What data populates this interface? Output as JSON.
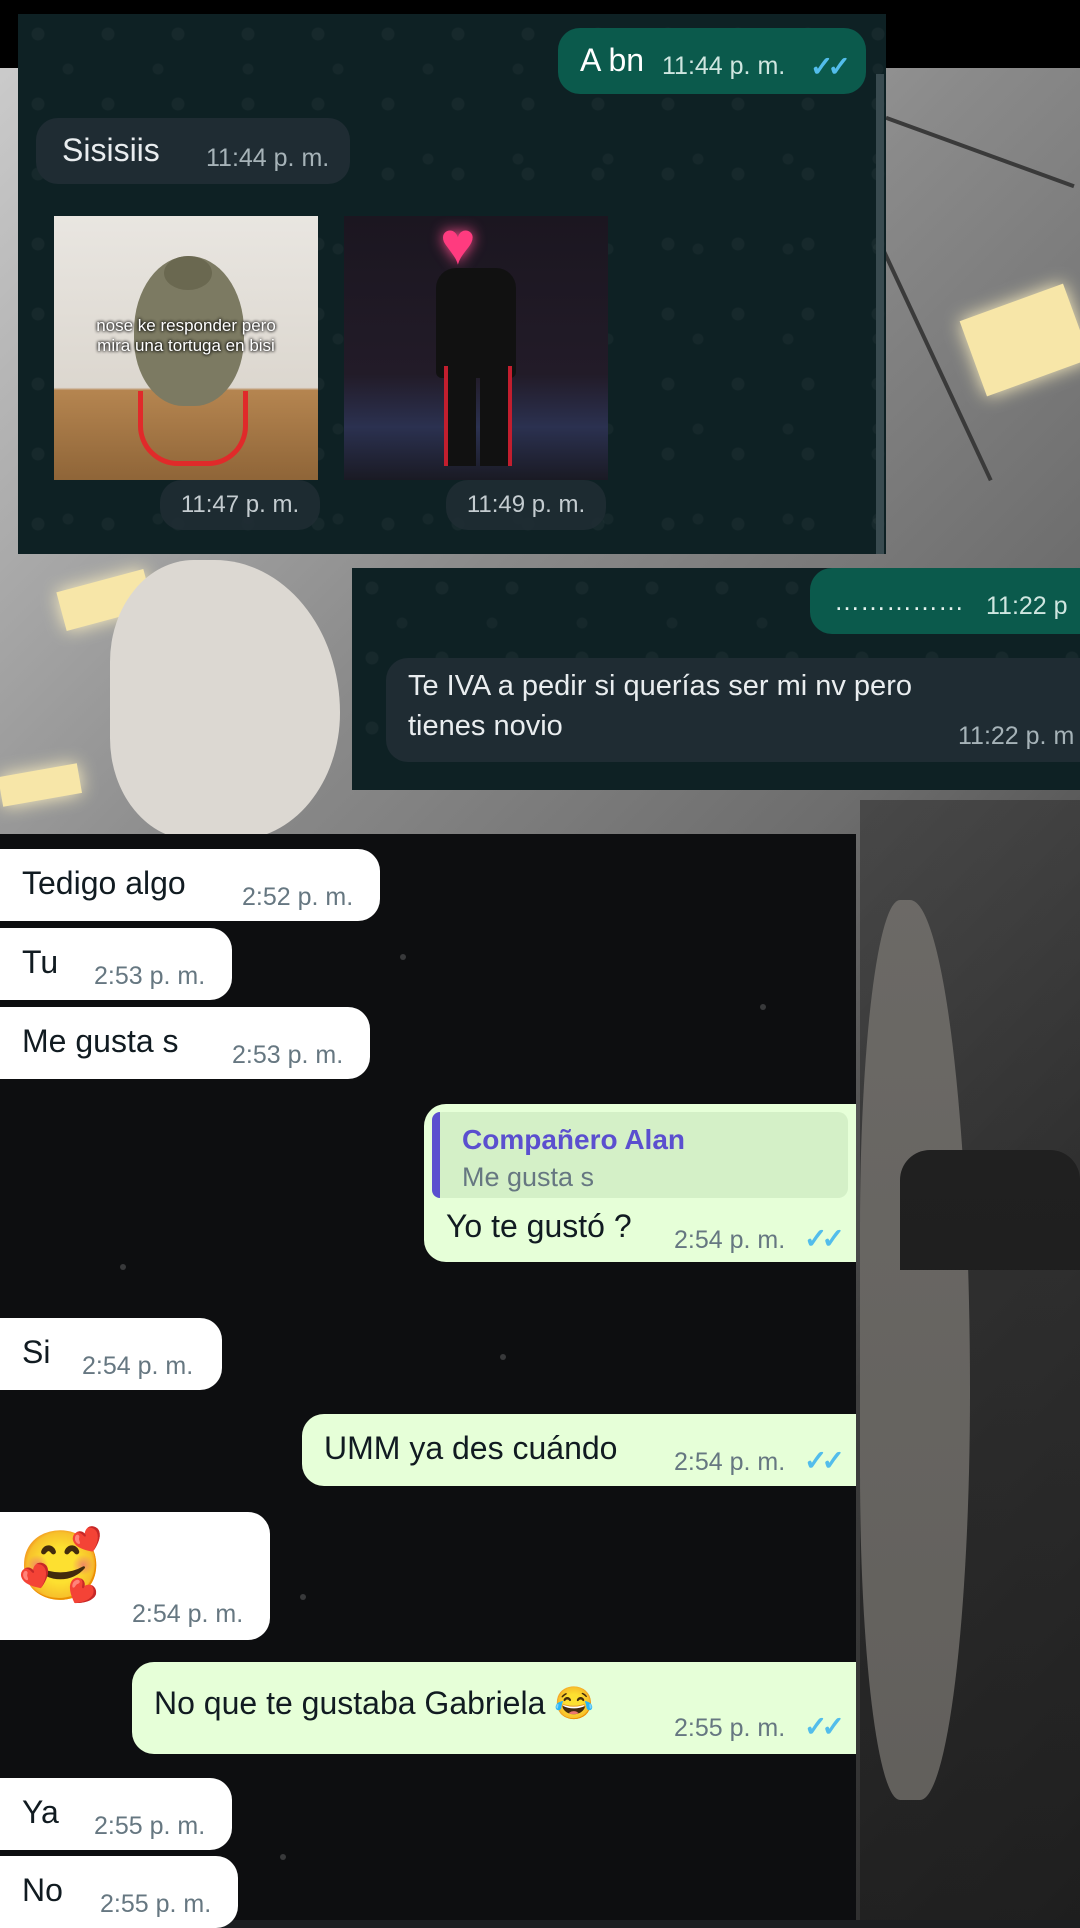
{
  "panel1": {
    "msg_out_1": {
      "text": "A bn",
      "time": "11:44 p. m."
    },
    "msg_in_1": {
      "text": "Sisisiis",
      "time": "11:44 p. m."
    },
    "image_1": {
      "caption": "nose ke responder pero mira una tortuga en bisi",
      "time": "11:47 p. m."
    },
    "image_2": {
      "time": "11:49 p. m."
    }
  },
  "panel2": {
    "msg_out_1": {
      "text": "……………",
      "time": "11:22 p"
    },
    "msg_in_1": {
      "text_line1": "Te IVA a pedir si querías ser mi nv pero",
      "text_line2": "tienes novio",
      "time": "11:22 p. m"
    }
  },
  "panel3": {
    "messages": [
      {
        "text": "Tedigo algo",
        "time": "2:52 p. m."
      },
      {
        "text": "Tu",
        "time": "2:53 p. m."
      },
      {
        "text": "Me gusta s",
        "time": "2:53 p. m."
      }
    ],
    "reply": {
      "quote_author": "Compañero Alan",
      "quote_text": "Me gusta s",
      "text": "Yo te gustó ?",
      "time": "2:54 p. m."
    },
    "msg_si": {
      "text": "Si",
      "time": "2:54 p. m."
    },
    "msg_umm": {
      "text": "UMM ya des cuándo",
      "time": "2:54 p. m."
    },
    "msg_emoji": {
      "emoji": "🥰",
      "time": "2:54 p. m."
    },
    "msg_gabriela": {
      "text": "No que te gustaba Gabriela 😂",
      "time": "2:55 p. m."
    },
    "msg_ya": {
      "text": "Ya",
      "time": "2:55 p. m."
    },
    "msg_no": {
      "text": "No",
      "time": "2:55 p. m."
    }
  },
  "ticks": "✓✓",
  "colors": {
    "tick_blue": "#53bdeb",
    "out_dark": "#0b5a4c",
    "out_light": "#e6ffd8",
    "quote_bar": "#5b4fcf"
  }
}
